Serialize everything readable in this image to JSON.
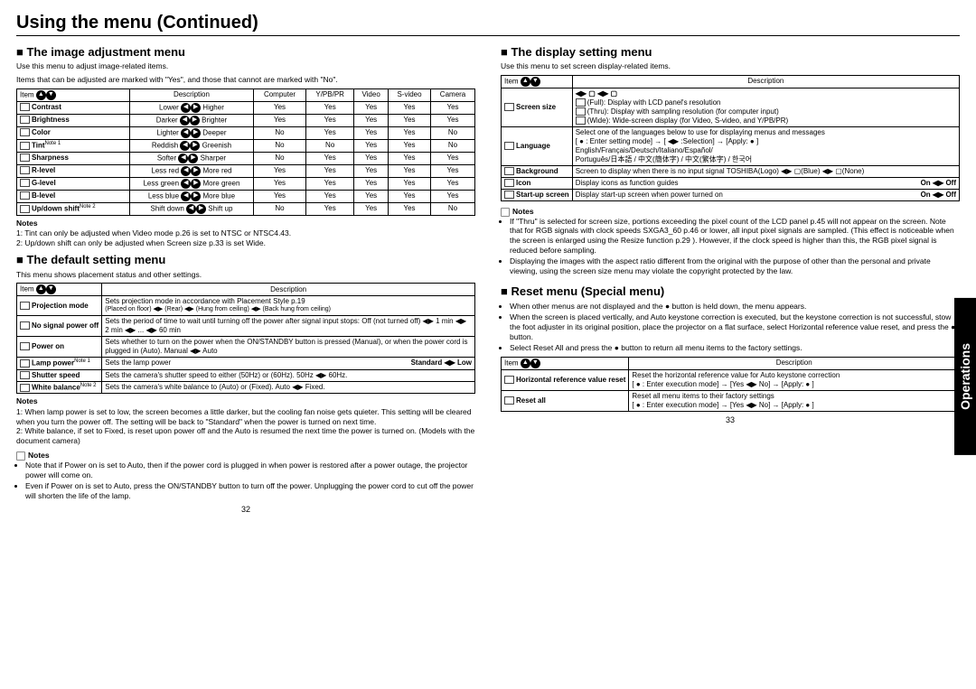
{
  "title": "Using the menu (Continued)",
  "sideTab": "Operations",
  "left": {
    "sec1": {
      "h": "The image adjustment menu",
      "intro1": "Use this menu to adjust image-related items.",
      "intro2": "Items that can be adjusted are marked with \"Yes\", and those that cannot are marked with \"No\".",
      "cols": [
        "Item",
        "Description",
        "Computer",
        "Y/PB/PR",
        "Video",
        "S-video",
        "Camera"
      ],
      "rows": [
        {
          "item": "Contrast",
          "lo": "Lower",
          "hi": "Higher",
          "v": [
            "Yes",
            "Yes",
            "Yes",
            "Yes",
            "Yes"
          ]
        },
        {
          "item": "Brightness",
          "lo": "Darker",
          "hi": "Brighter",
          "v": [
            "Yes",
            "Yes",
            "Yes",
            "Yes",
            "Yes"
          ]
        },
        {
          "item": "Color",
          "lo": "Lighter",
          "hi": "Deeper",
          "v": [
            "No",
            "Yes",
            "Yes",
            "Yes",
            "No"
          ]
        },
        {
          "item": "Tint",
          "note": "Note 1",
          "lo": "Reddish",
          "hi": "Greenish",
          "v": [
            "No",
            "No",
            "Yes",
            "Yes",
            "No"
          ]
        },
        {
          "item": "Sharpness",
          "lo": "Softer",
          "hi": "Sharper",
          "v": [
            "No",
            "Yes",
            "Yes",
            "Yes",
            "Yes"
          ]
        },
        {
          "item": "R-level",
          "lo": "Less red",
          "hi": "More red",
          "v": [
            "Yes",
            "Yes",
            "Yes",
            "Yes",
            "Yes"
          ]
        },
        {
          "item": "G-level",
          "lo": "Less green",
          "hi": "More green",
          "v": [
            "Yes",
            "Yes",
            "Yes",
            "Yes",
            "Yes"
          ]
        },
        {
          "item": "B-level",
          "lo": "Less blue",
          "hi": "More blue",
          "v": [
            "Yes",
            "Yes",
            "Yes",
            "Yes",
            "Yes"
          ]
        },
        {
          "item": "Up/down shift",
          "note": "Note 2",
          "lo": "Shift down",
          "hi": "Shift up",
          "v": [
            "No",
            "Yes",
            "Yes",
            "Yes",
            "No"
          ]
        }
      ],
      "notesH": "Notes",
      "n1": "1: Tint can only be adjusted when Video mode p.26 is set to NTSC or NTSC4.43.",
      "n2": "2: Up/down shift can only be adjusted when Screen size p.33 is set Wide."
    },
    "sec2": {
      "h": "The default setting menu",
      "intro": "This menu shows placement status and other settings.",
      "cols": [
        "Item",
        "Description"
      ],
      "rows": [
        {
          "item": "Projection mode",
          "desc": "Sets projection mode in accordance with Placement Style p.19",
          "extra": "(Placed on floor) ◀▶ (Rear) ◀▶ (Hung from ceiling) ◀▶ (Back hung from ceiling)"
        },
        {
          "item": "No signal power off",
          "desc": "Sets the period of time to wait until turning off the power after signal input stops: Off (not turned off) ◀▶ 1 min ◀▶ 2 min ◀▶ ... ◀▶ 60 min"
        },
        {
          "item": "Power on",
          "desc": "Sets whether to turn on the power when the ON/STANDBY button is pressed (Manual), or when the power cord is plugged in (Auto).  Manual ◀▶ Auto"
        },
        {
          "item": "Lamp power",
          "note": "Note 1",
          "desc": "Sets the lamp power",
          "right": "Standard ◀▶ Low"
        },
        {
          "item": "Shutter speed",
          "desc": "Sets the camera's shutter speed to either (50Hz) or (60Hz). 50Hz ◀▶ 60Hz."
        },
        {
          "item": "White balance",
          "note": "Note 2",
          "desc": "Sets the camera's white balance to (Auto) or (Fixed).  Auto ◀▶ Fixed."
        }
      ],
      "notesH": "Notes",
      "n1": "1: When lamp power is set to low, the screen becomes a little darker, but the cooling fan noise gets quieter. This setting will be cleared when you turn the power off. The setting will be back to \"Standard\" when the power is turned on next time.",
      "n2": "2: White balance, if set to Fixed, is reset upon power off and the Auto is resumed the next time the power is turned on. (Models with the document camera)",
      "notesIconH": "Notes",
      "bul1": "Note that if Power on is set to Auto, then if the power cord is plugged in when power is restored after a power outage, the projector power will come on.",
      "bul2": "Even if Power on is set to Auto, press the ON/STANDBY button to turn off the power. Unplugging the power cord to cut off the power will shorten the life of the lamp."
    },
    "pg": "32"
  },
  "right": {
    "sec1": {
      "h": "The display setting menu",
      "intro": "Use this menu to set screen display-related items.",
      "cols": [
        "Item",
        "Description"
      ],
      "rows": [
        {
          "item": "Screen size",
          "desc1": "(Full): Display with LCD panel's resolution",
          "desc2": "(Thru): Display with sampling resolution (for computer input)",
          "desc3": "(Wide): Wide-screen display (for Video, S-video, and Y/PB/PR)",
          "head": "◀▶ ▢ ◀▶ ▢"
        },
        {
          "item": "Language",
          "desc": "Select one of the languages below to use for displaying menus and messages",
          "line2": "[ ● : Enter setting mode] → [ ◀▶ :Selection] → [Apply: ● ]",
          "line3": "English/Français/Deutsch/Italiano/Español/",
          "line4": "Português/日本語 / 中文(簡体字) / 中文(繁体字) / 한국어"
        },
        {
          "item": "Background",
          "desc": "Screen to display when there is no input signal TOSHIBA(Logo) ◀▶ ▢(Blue) ◀▶ ▢(None)"
        },
        {
          "item": "Icon",
          "desc": "Display icons as function guides",
          "right": "On ◀▶ Off"
        },
        {
          "item": "Start-up screen",
          "desc": "Display start-up screen when power turned on",
          "right": "On ◀▶ Off"
        }
      ],
      "notesIconH": "Notes",
      "bul1": "If \"Thru\" is selected for screen size, portions exceeding the pixel count of the LCD panel p.45 will not appear on the screen. Note that for RGB signals with clock speeds SXGA3_60 p.46 or lower, all input pixel signals are sampled. (This effect is noticeable when the screen is enlarged using the Resize function p.29 ). However, if the clock speed is higher than this, the RGB pixel signal is reduced before sampling.",
      "bul2": "Displaying the images with the aspect ratio different from the original with the purpose of other than the personal and private viewing, using the screen size menu may violate the copyright protected by the law."
    },
    "sec2": {
      "h": "Reset menu (Special menu)",
      "b1": "When other menus are not displayed and the ● button is held down, the menu appears.",
      "b2": "When the screen is placed vertically, and Auto keystone correction is executed, but the keystone correction is not successful, stow the foot adjuster in its original position, place the projector on a flat surface, select Horizontal reference value reset, and press the ● button.",
      "b3": "Select Reset All and press the ● button to return all menu items to the factory settings.",
      "cols": [
        "Item",
        "Description"
      ],
      "rows": [
        {
          "item": "Horizontal reference value reset",
          "desc": "Reset the horizontal reference value for Auto keystone correction",
          "line2": "[ ● : Enter execution mode] → [Yes ◀▶ No] → [Apply: ● ]"
        },
        {
          "item": "Reset all",
          "desc": "Reset all menu items to their factory settings",
          "line2": "[ ● : Enter execution mode] → [Yes ◀▶ No] → [Apply: ● ]"
        }
      ]
    },
    "pg": "33"
  }
}
